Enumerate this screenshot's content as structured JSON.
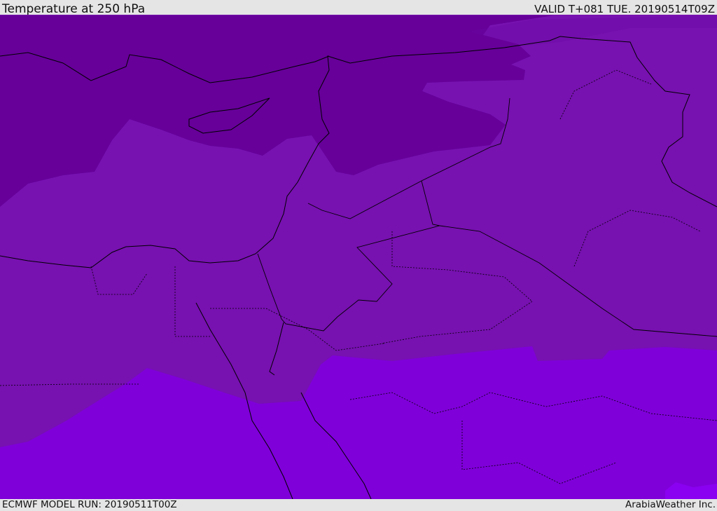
{
  "header": {
    "title": "Temperature at 250 hPa",
    "valid": "VALID T+081 TUE. 20190514T09Z"
  },
  "footer": {
    "model_run": "ECMWF MODEL RUN: 20190511T00Z",
    "credit": "ArabiaWeather Inc."
  },
  "colors": {
    "cold_band": "#660099",
    "mid_band": "#7711b0",
    "warm_band": "#7f00d9",
    "border": "#000000"
  }
}
